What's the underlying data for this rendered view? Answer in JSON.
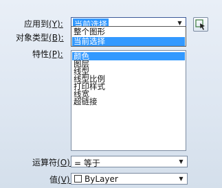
{
  "apply_to": {
    "label": "应用到",
    "hotkey": "(Y):",
    "value": "当前选择",
    "options": [
      "整个图形",
      "当前选择"
    ],
    "selected_option": "当前选择"
  },
  "object_type": {
    "label": "对象类型",
    "hotkey": "(B):"
  },
  "properties": {
    "label": "特性",
    "hotkey": "(P):",
    "items": [
      "颜色",
      "图层",
      "线型",
      "线型比例",
      "打印样式",
      "线宽",
      "超链接"
    ],
    "selected": "颜色"
  },
  "operator": {
    "label": "运算符",
    "hotkey": "(O):",
    "value": "= 等于"
  },
  "value_field": {
    "label": "值",
    "hotkey": "(V):",
    "value": "ByLayer",
    "swatch_color": "#ffffff"
  },
  "icons": {
    "quick_select": "select-objects-icon",
    "dropdown_arrow": "chevron-down-icon"
  },
  "colors": {
    "selection": "#3399ff",
    "panel_bg": "#dfe8f3"
  }
}
